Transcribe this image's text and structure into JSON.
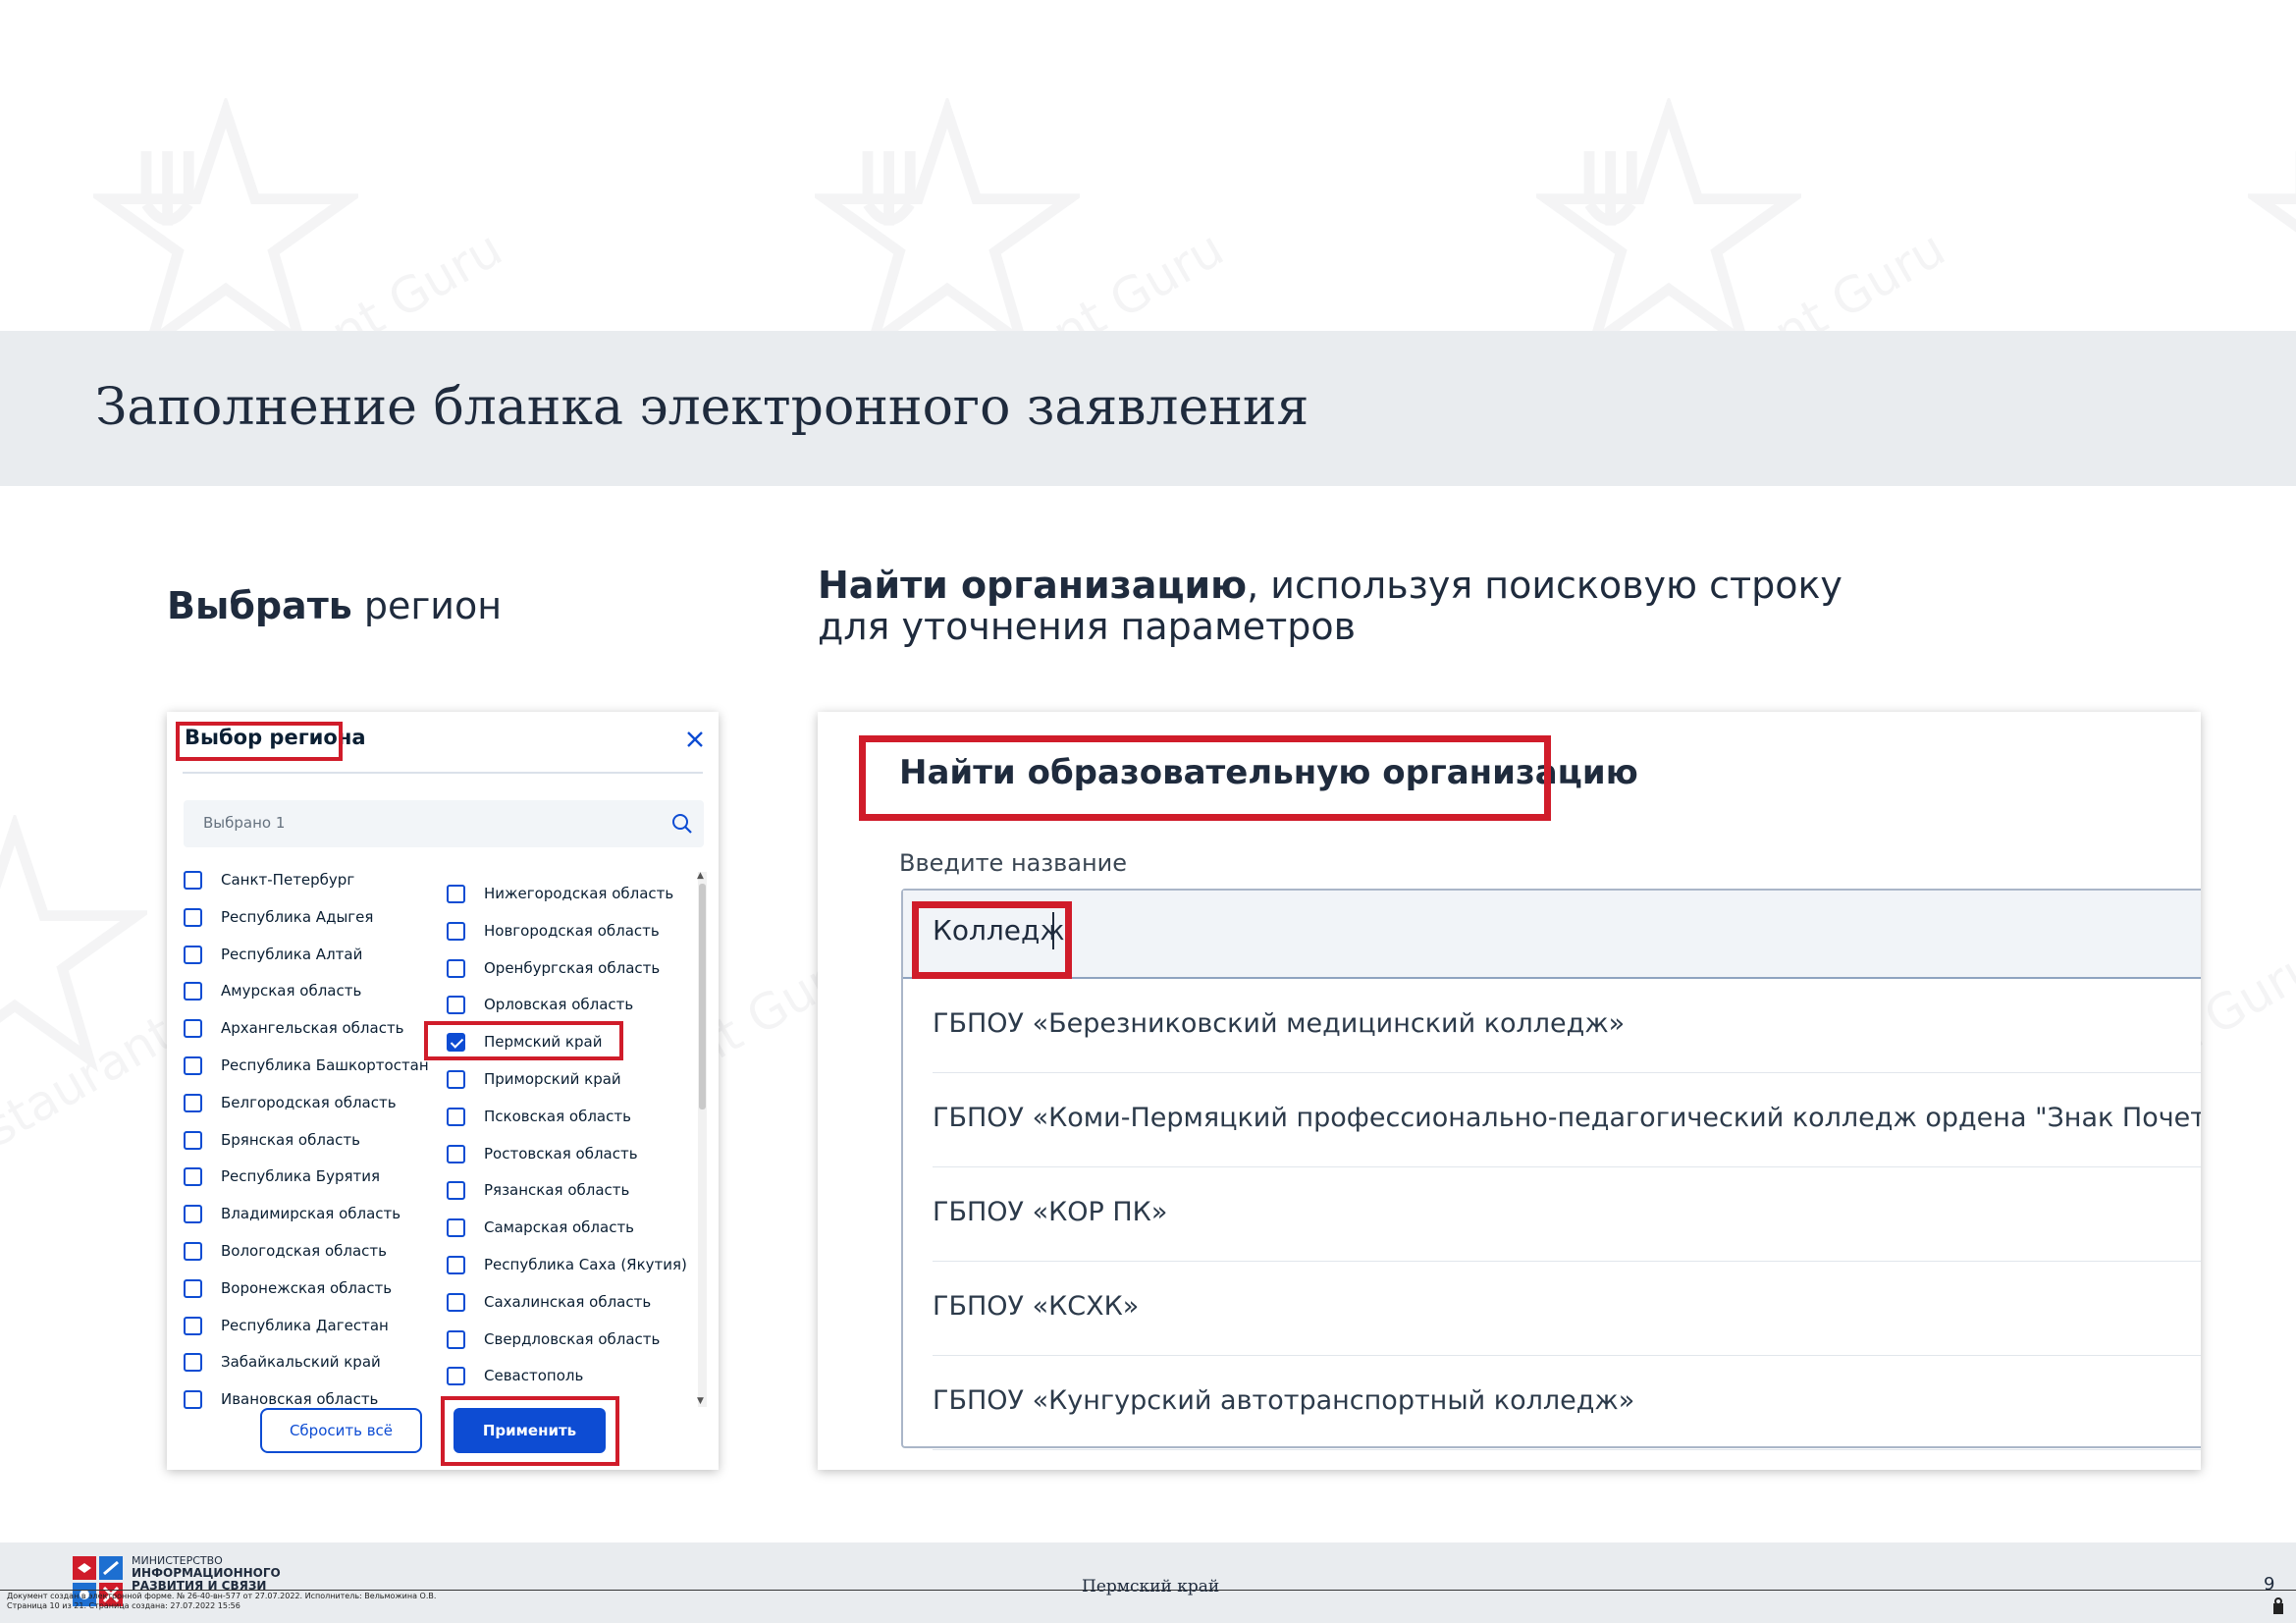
{
  "watermark": {
    "text": "Restaurant Guru"
  },
  "header": {
    "title": "Заполнение бланка электронного заявления"
  },
  "step1": {
    "bold": "Выбрать",
    "rest": " регион"
  },
  "step2": {
    "bold": "Найти организацию",
    "rest_line1": ", используя поисковую строку",
    "line2": "для уточнения параметров"
  },
  "region_dialog": {
    "title": "Выбор региона",
    "close_icon": "close-icon",
    "search_placeholder": "Выбрано 1",
    "search_icon": "search-icon",
    "left_column": [
      "Санкт-Петербург",
      "Республика Адыгея",
      "Республика Алтай",
      "Амурская область",
      "Архангельская область",
      "Республика Башкортостан",
      "Белгородская область",
      "Брянская область",
      "Республика Бурятия",
      "Владимирская область",
      "Вологодская область",
      "Воронежская область",
      "Республика Дагестан",
      "Забайкальский край",
      "Ивановская область"
    ],
    "right_column": [
      "Нижегородская область",
      "Новгородская область",
      "Оренбургская область",
      "Орловская область",
      "Пермский край",
      "Приморский край",
      "Псковская область",
      "Ростовская область",
      "Рязанская область",
      "Самарская область",
      "Республика Саха (Якутия)",
      "Сахалинская область",
      "Свердловская область",
      "Севастополь"
    ],
    "checked": "Пермский край",
    "reset_label": "Сбросить всё",
    "apply_label": "Применить"
  },
  "org_search": {
    "title": "Найти образовательную организацию",
    "field_label": "Введите название",
    "input_value": "Колледж",
    "results": [
      "ГБПОУ «Березниковский медицинский колледж»",
      "ГБПОУ «Коми-Пермяцкий профессионально-педагогический колледж ордена \"Знак Почета\"»",
      "ГБПОУ «КОР ПК»",
      "ГБПОУ «КСХК»",
      "ГБПОУ «Кунгурский автотранспортный колледж»"
    ]
  },
  "footer": {
    "ministry_line1": "МИНИСТЕРСТВО",
    "ministry_line2": "ИНФОРМАЦИОННОГО",
    "ministry_line3": "РАЗВИТИЯ И СВЯЗИ",
    "region": "Пермский край",
    "page_number": "9",
    "doc_note_line1": "Документ создан в электронной форме. № 26-40-вн-577 от 27.07.2022. Исполнитель: Вельможина О.В.",
    "doc_note_line2": "Страница 10 из 21. Страница создана: 27.07.2022 15:56"
  },
  "colors": {
    "accent": "#0d4cd3",
    "highlight": "#d01c2a",
    "band": "#e9ecef"
  }
}
